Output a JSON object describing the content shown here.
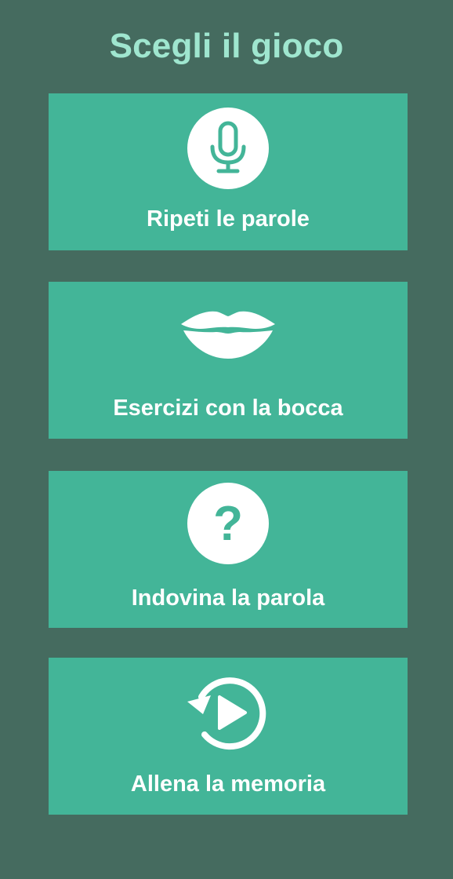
{
  "header": {
    "title": "Scegli il gioco"
  },
  "games": [
    {
      "label": "Ripeti le parole",
      "icon": "microphone-icon"
    },
    {
      "label": "Esercizi con la bocca",
      "icon": "lips-icon"
    },
    {
      "label": "Indovina la parola",
      "icon": "question-mark-icon"
    },
    {
      "label": "Allena la memoria",
      "icon": "replay-icon"
    }
  ],
  "icon_glyphs": {
    "question_mark": "?"
  },
  "colors": {
    "background": "#456b5f",
    "title": "#9fe6cf",
    "card": "#43b598",
    "text": "#ffffff"
  }
}
